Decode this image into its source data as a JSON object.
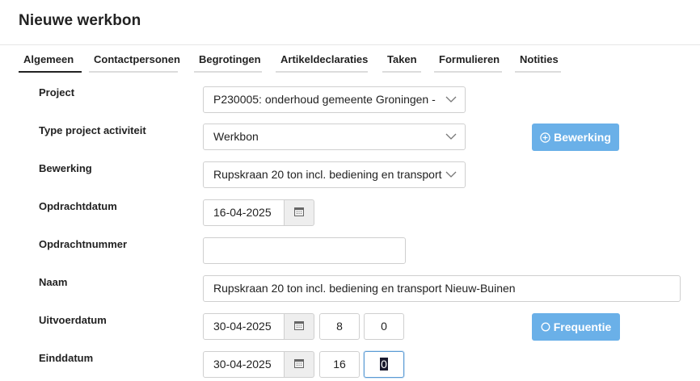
{
  "page": {
    "title": "Nieuwe werkbon"
  },
  "tabs": [
    {
      "label": "Algemeen",
      "active": true
    },
    {
      "label": "Contactpersonen"
    },
    {
      "label": "Begrotingen"
    },
    {
      "label": "Artikeldeclaraties"
    },
    {
      "label": "Taken"
    },
    {
      "label": "Formulieren"
    },
    {
      "label": "Notities"
    }
  ],
  "form": {
    "project": {
      "label": "Project",
      "value": "P230005: onderhoud gemeente Groningen - "
    },
    "type_activiteit": {
      "label": "Type project activiteit",
      "value": "Werkbon"
    },
    "bewerking": {
      "label": "Bewerking",
      "value": "Rupskraan 20 ton incl. bediening en transport"
    },
    "opdrachtdatum": {
      "label": "Opdrachtdatum",
      "value": "16-04-2025"
    },
    "opdrachtnummer": {
      "label": "Opdrachtnummer",
      "value": ""
    },
    "naam": {
      "label": "Naam",
      "value": "Rupskraan 20 ton incl. bediening en transport Nieuw-Buinen"
    },
    "uitvoerdatum": {
      "label": "Uitvoerdatum",
      "date": "30-04-2025",
      "hour": "8",
      "minute": "0"
    },
    "einddatum": {
      "label": "Einddatum",
      "date": "30-04-2025",
      "hour": "16",
      "minute": "0"
    }
  },
  "buttons": {
    "bewerking": {
      "label": "Bewerking",
      "icon": "plus-circle-icon"
    },
    "frequentie": {
      "label": "Frequentie",
      "icon": "circle-icon"
    }
  },
  "colors": {
    "accent_button": "#6ab0e8",
    "active_tab": "#222222",
    "focus": "#5b9bd5"
  }
}
